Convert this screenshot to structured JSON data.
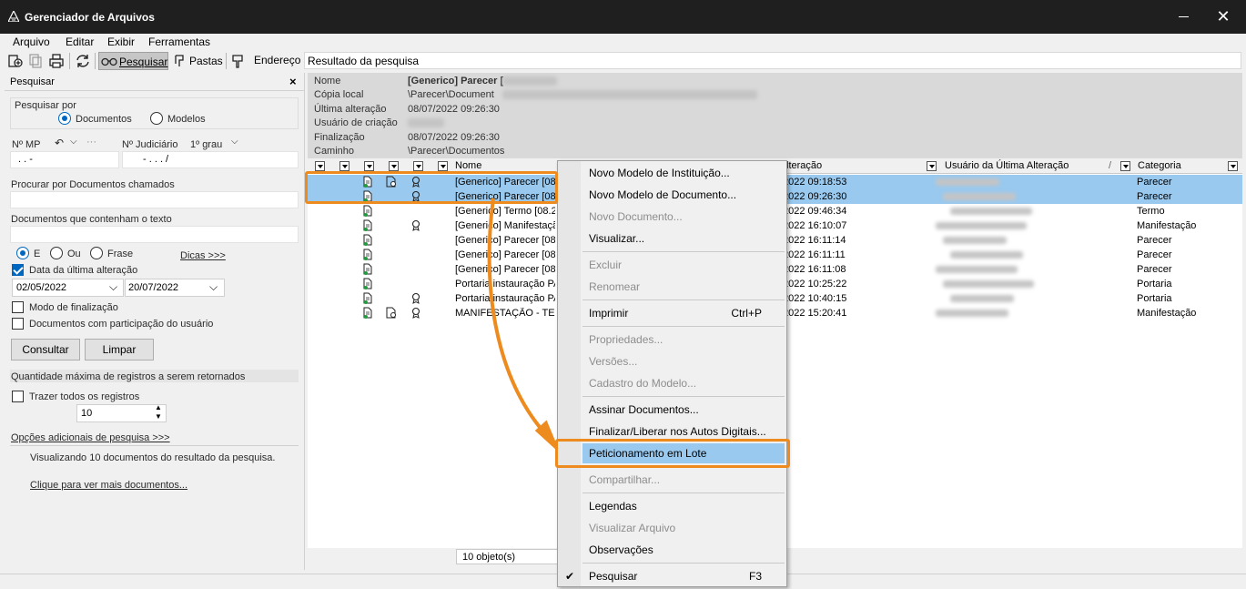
{
  "window": {
    "title": "Gerenciador de Arquivos"
  },
  "menu": [
    "Arquivo",
    "Editar",
    "Exibir",
    "Ferramentas"
  ],
  "toolbar": {
    "pesquisar": "Pesquisar",
    "pastas": "Pastas",
    "endereco": "Endereço",
    "address_value": "Resultado da pesquisa"
  },
  "search": {
    "panel_title": "Pesquisar",
    "pesquisar_por": "Pesquisar por",
    "opt_documentos": "Documentos",
    "opt_modelos": "Modelos",
    "num_mp": "Nº MP",
    "num_mp_value": ".   .      -",
    "num_jud": "Nº Judiciário",
    "grau": "1º grau",
    "num_jud_value": "-   .  .  .   /",
    "procurar_label": "Procurar por Documentos chamados",
    "contenham_label": "Documentos que contenham o texto",
    "op_e": "E",
    "op_ou": "Ou",
    "op_frase": "Frase",
    "dicas": "Dicas >>>",
    "data_ultima": "Data da última alteração",
    "date_from": "02/05/2022",
    "date_to": "20/07/2022",
    "modo_finalizacao": "Modo de finalização",
    "participacao": "Documentos com participação do usuário",
    "consultar": "Consultar",
    "limpar": "Limpar",
    "qtd_max": "Quantidade máxima de registros a serem retornados",
    "trazer_todos": "Trazer todos os registros",
    "qtd_value": "10",
    "opcoes_adicionais": "Opções adicionais de pesquisa >>>",
    "visualizando": "Visualizando 10 documentos do resultado da pesquisa.",
    "clique_mais": "Clique para ver mais documentos..."
  },
  "details": {
    "labels": [
      "Nome",
      "Cópia local",
      "Última alteração",
      "Usuário de criação",
      "Finalização",
      "Caminho"
    ],
    "values": [
      "[Generico] Parecer [",
      "\\Parecer\\Document",
      "08/07/2022 09:26:30",
      "",
      "08/07/2022 09:26:30",
      "\\Parecer\\Documentos"
    ]
  },
  "grid": {
    "headers": {
      "nome": "Nome",
      "alteracao": "lteração",
      "usuario": "Usuário da Última Alteração",
      "categoria": "Categoria"
    },
    "rows": [
      {
        "nome": "[Generico] Parecer [08",
        "data": "2022 09:18:53",
        "cat": "Parecer",
        "sel": true
      },
      {
        "nome": "[Generico] Parecer [08",
        "data": "2022 09:26:30",
        "cat": "Parecer",
        "sel": true
      },
      {
        "nome": "[Generico] Termo [08.2",
        "data": "2022 09:46:34",
        "cat": "Termo",
        "sel": false
      },
      {
        "nome": "[Generico] Manifestação",
        "data": "2022 16:10:07",
        "cat": "Manifestação",
        "sel": false
      },
      {
        "nome": "[Generico] Parecer [08",
        "data": "2022 16:11:14",
        "cat": "Parecer",
        "sel": false
      },
      {
        "nome": "[Generico] Parecer [08",
        "data": "2022 16:11:11",
        "cat": "Parecer",
        "sel": false
      },
      {
        "nome": "[Generico] Parecer [08",
        "data": "2022 16:11:08",
        "cat": "Parecer",
        "sel": false
      },
      {
        "nome": "Portaria instauração PA",
        "data": "2022 10:25:22",
        "cat": "Portaria",
        "sel": false
      },
      {
        "nome": "Portaria instauração PA",
        "data": "2022 10:40:15",
        "cat": "Portaria",
        "sel": false
      },
      {
        "nome": "MANIFESTAÇÃO - TEST",
        "data": "2022 15:20:41",
        "cat": "Manifestação",
        "sel": false
      }
    ],
    "count": "10 objeto(s)"
  },
  "context_menu": {
    "items": [
      "Novo Modelo de Instituição...",
      "Novo Modelo de Documento...",
      "Novo Documento...",
      "Visualizar...",
      "Excluir",
      "Renomear",
      "Imprimir",
      "Propriedades...",
      "Versões...",
      "Cadastro do Modelo...",
      "Assinar Documentos...",
      "Finalizar/Liberar nos Autos Digitais...",
      "Peticionamento em Lote",
      "Compartilhar...",
      "Legendas",
      "Visualizar Arquivo",
      "Observações",
      "Pesquisar"
    ],
    "shortcut_imprimir": "Ctrl+P",
    "shortcut_pesquisar": "F3"
  },
  "colors": {
    "selection": "#99c9ef",
    "annotation": "#ed8b1f",
    "accent": "#0067c0"
  }
}
